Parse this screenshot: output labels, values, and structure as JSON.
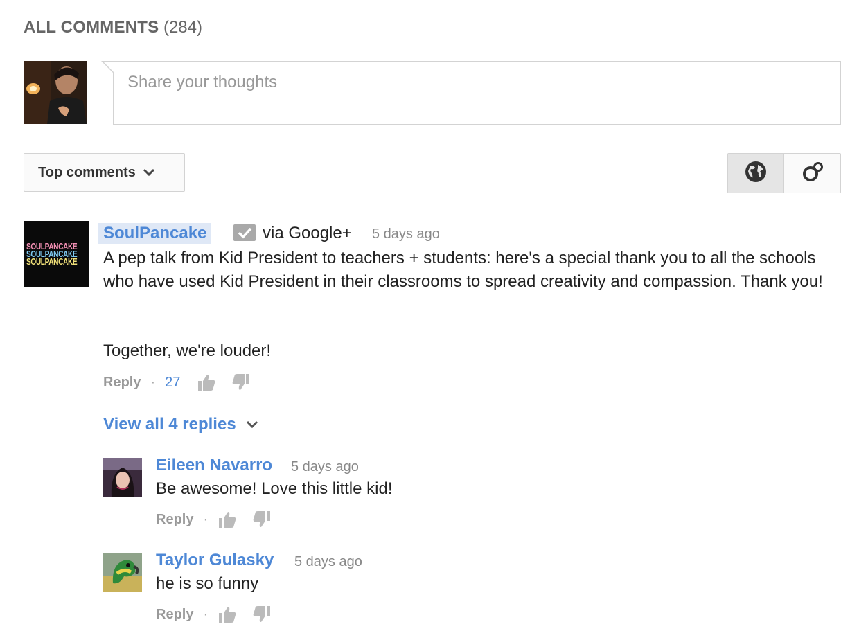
{
  "header": {
    "label": "ALL COMMENTS",
    "count": "(284)"
  },
  "compose": {
    "placeholder": "Share your thoughts"
  },
  "sort": {
    "label": "Top comments"
  },
  "toggles": [
    {
      "icon": "globe-icon",
      "active": true
    },
    {
      "icon": "google-circles-icon",
      "active": false
    }
  ],
  "comment": {
    "author": "SoulPancake",
    "avatar_text": [
      "SOULPANCAKE",
      "SOULPANCAKE",
      "SOULPANCAKE"
    ],
    "via": "via Google+",
    "time": "5 days ago",
    "text": "A pep talk from Kid President to teachers + students: here's a special thank you to all the schools who have used Kid President in their classrooms to spread creativity and compassion. Thank you!",
    "text2": "Together, we're louder!",
    "reply_label": "Reply",
    "separator": "·",
    "likes": "27"
  },
  "view_replies": {
    "label": "View all 4 replies"
  },
  "replies": [
    {
      "author": "Eileen Navarro",
      "time": "5 days ago",
      "text": "Be awesome! Love this little kid!",
      "reply_label": "Reply",
      "separator": "·"
    },
    {
      "author": "Taylor Gulasky",
      "time": "5 days ago",
      "text": "he is so funny",
      "reply_label": "Reply",
      "separator": "·"
    }
  ],
  "colors": {
    "link": "#4e88d6",
    "muted": "#888888",
    "border": "#d3d3d3",
    "author_highlight": "#dfe8f6"
  }
}
